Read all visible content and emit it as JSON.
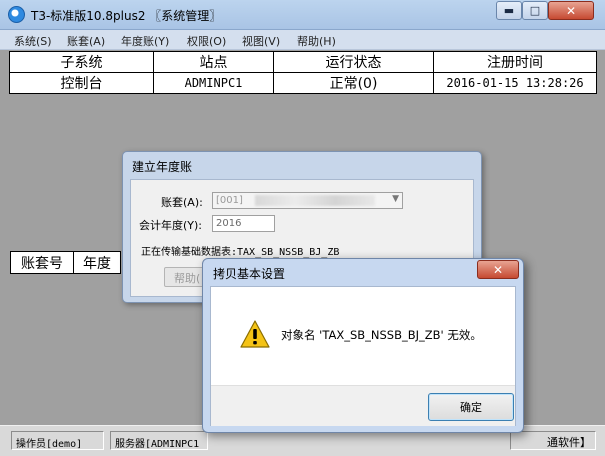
{
  "window": {
    "title": "T3-标准版10.8plus2 〖系统管理〗",
    "min_glyph": "▬",
    "max_glyph": "□",
    "close_glyph": "✕",
    "icon": "app-logo-icon"
  },
  "menu": [
    {
      "label": "系统(S)"
    },
    {
      "label": "账套(A)"
    },
    {
      "label": "年度账(Y)"
    },
    {
      "label": "权限(O)"
    },
    {
      "label": "视图(V)"
    },
    {
      "label": "帮助(H)"
    }
  ],
  "subsystem_table": {
    "headers": [
      "子系统",
      "站点",
      "运行状态",
      "注册时间"
    ],
    "rows": [
      [
        "控制台",
        "ADMINPC1",
        "正常(0)",
        "2016-01-15 13:28:26"
      ]
    ]
  },
  "account_table": {
    "headers": [
      "账套号",
      "年度"
    ]
  },
  "statusbar": {
    "operator": "操作员[demo]",
    "server": "服务器[ADMINPC1",
    "right_text": "通软件】"
  },
  "dialog_create_year": {
    "title": "建立年度账",
    "account_label": "账套(A):",
    "account_value": "[001]",
    "year_label": "会计年度(Y):",
    "year_value": "2016",
    "progress_text": "正在传输基础数据表:TAX_SB_NSSB_BJ_ZB",
    "help_button": "帮助(",
    "dropdown_glyph": "▼"
  },
  "dialog_copy_settings": {
    "title": "拷贝基本设置",
    "close_glyph": "✕",
    "message": "对象名 'TAX_SB_NSSB_BJ_ZB' 无效。",
    "ok_button": "确定",
    "icon": "warning-icon"
  },
  "colors": {
    "desktop_bg": "#a0a0a0",
    "titlebar": "#bcd4ee",
    "close_red": "#c64a32",
    "warning_yellow": "#f4c316"
  }
}
